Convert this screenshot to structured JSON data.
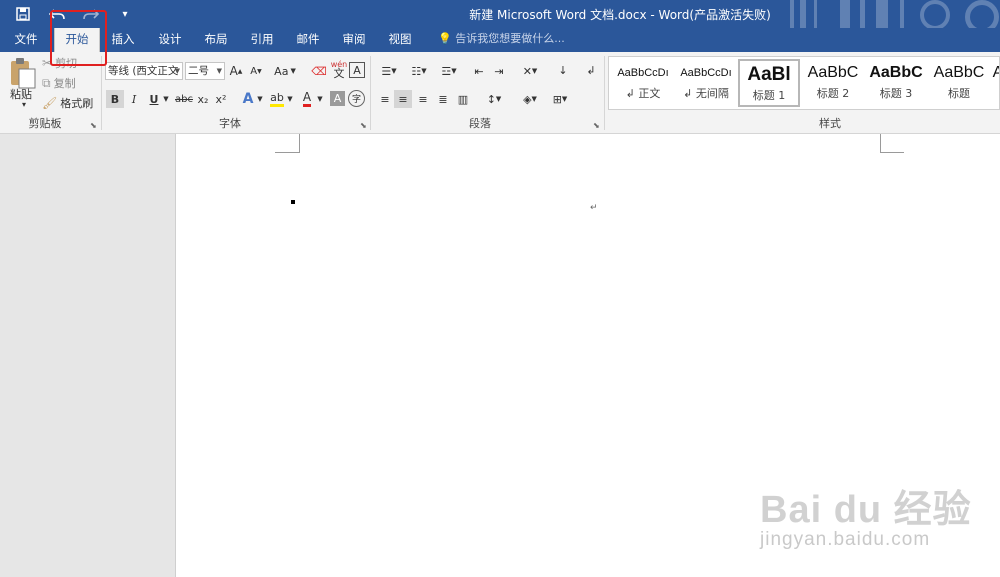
{
  "titlebar": {
    "title": "新建 Microsoft Word 文档.docx - Word(产品激活失败)",
    "qat": {
      "save_icon": "save-icon",
      "undo_icon": "undo-icon",
      "redo_icon": "redo-icon",
      "customize_icon": "customize-qat-icon"
    }
  },
  "tabs": [
    "文件",
    "开始",
    "插入",
    "设计",
    "布局",
    "引用",
    "邮件",
    "审阅",
    "视图"
  ],
  "active_tab": "开始",
  "tell_me": "告诉我您想要做什么...",
  "clipboard": {
    "paste": "粘贴",
    "cut": "剪切",
    "copy": "复制",
    "format_painter": "格式刷",
    "label": "剪贴板"
  },
  "font": {
    "font_name": "等线 (西文正文",
    "font_size": "二号",
    "label": "字体",
    "change_case": "Aa",
    "phonetic": "wén",
    "phonetic_sub": "文",
    "bold": "B",
    "italic": "I",
    "underline": "U",
    "strike": "abc",
    "subscript": "x₂",
    "superscript": "x²",
    "enclose": "字"
  },
  "paragraph": {
    "label": "段落"
  },
  "styles": {
    "label": "样式",
    "items": [
      {
        "sample": "AaBbCcDı",
        "name": "↲ 正文"
      },
      {
        "sample": "AaBbCcDı",
        "name": "↲ 无间隔"
      },
      {
        "sample": "AaBl",
        "name": "标题 1"
      },
      {
        "sample": "AaBbC",
        "name": "标题 2"
      },
      {
        "sample": "AaBbC",
        "name": "标题 3"
      },
      {
        "sample": "AaBbC",
        "name": "标题"
      },
      {
        "sample": "A",
        "name": ""
      }
    ]
  },
  "document": {
    "paragraph_mark": "↵"
  },
  "watermark": {
    "brand": "Bai du 经验",
    "url": "jingyan.baidu.com"
  },
  "colors": {
    "accent": "#2b579a",
    "highlight_box": "#e02020",
    "font_color": "#e02020",
    "highlight_color": "#ffe800"
  }
}
